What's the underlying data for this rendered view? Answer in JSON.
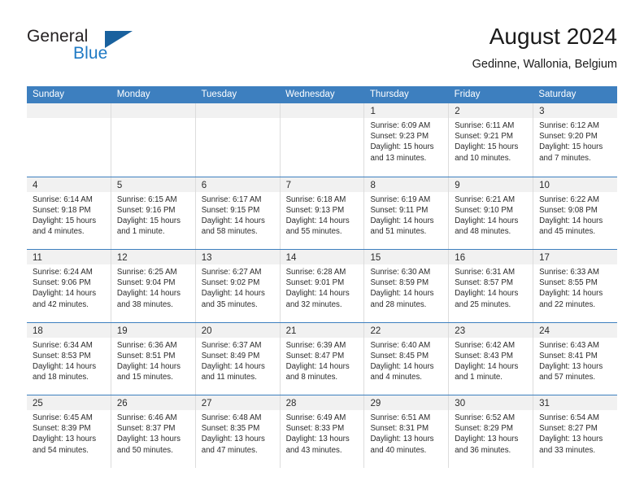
{
  "brand": {
    "name_part1": "General",
    "name_part2": "Blue",
    "flag_color": "#19619e",
    "blue_text_color": "#1f7ac4"
  },
  "header": {
    "title": "August 2024",
    "location": "Gedinne, Wallonia, Belgium",
    "accent_color": "#3d7fbf"
  },
  "weekday_headers": [
    "Sunday",
    "Monday",
    "Tuesday",
    "Wednesday",
    "Thursday",
    "Friday",
    "Saturday"
  ],
  "weeks": [
    [
      {
        "day": "",
        "sunrise": "",
        "sunset": "",
        "daylight1": "",
        "daylight2": ""
      },
      {
        "day": "",
        "sunrise": "",
        "sunset": "",
        "daylight1": "",
        "daylight2": ""
      },
      {
        "day": "",
        "sunrise": "",
        "sunset": "",
        "daylight1": "",
        "daylight2": ""
      },
      {
        "day": "",
        "sunrise": "",
        "sunset": "",
        "daylight1": "",
        "daylight2": ""
      },
      {
        "day": "1",
        "sunrise": "Sunrise: 6:09 AM",
        "sunset": "Sunset: 9:23 PM",
        "daylight1": "Daylight: 15 hours",
        "daylight2": "and 13 minutes."
      },
      {
        "day": "2",
        "sunrise": "Sunrise: 6:11 AM",
        "sunset": "Sunset: 9:21 PM",
        "daylight1": "Daylight: 15 hours",
        "daylight2": "and 10 minutes."
      },
      {
        "day": "3",
        "sunrise": "Sunrise: 6:12 AM",
        "sunset": "Sunset: 9:20 PM",
        "daylight1": "Daylight: 15 hours",
        "daylight2": "and 7 minutes."
      }
    ],
    [
      {
        "day": "4",
        "sunrise": "Sunrise: 6:14 AM",
        "sunset": "Sunset: 9:18 PM",
        "daylight1": "Daylight: 15 hours",
        "daylight2": "and 4 minutes."
      },
      {
        "day": "5",
        "sunrise": "Sunrise: 6:15 AM",
        "sunset": "Sunset: 9:16 PM",
        "daylight1": "Daylight: 15 hours",
        "daylight2": "and 1 minute."
      },
      {
        "day": "6",
        "sunrise": "Sunrise: 6:17 AM",
        "sunset": "Sunset: 9:15 PM",
        "daylight1": "Daylight: 14 hours",
        "daylight2": "and 58 minutes."
      },
      {
        "day": "7",
        "sunrise": "Sunrise: 6:18 AM",
        "sunset": "Sunset: 9:13 PM",
        "daylight1": "Daylight: 14 hours",
        "daylight2": "and 55 minutes."
      },
      {
        "day": "8",
        "sunrise": "Sunrise: 6:19 AM",
        "sunset": "Sunset: 9:11 PM",
        "daylight1": "Daylight: 14 hours",
        "daylight2": "and 51 minutes."
      },
      {
        "day": "9",
        "sunrise": "Sunrise: 6:21 AM",
        "sunset": "Sunset: 9:10 PM",
        "daylight1": "Daylight: 14 hours",
        "daylight2": "and 48 minutes."
      },
      {
        "day": "10",
        "sunrise": "Sunrise: 6:22 AM",
        "sunset": "Sunset: 9:08 PM",
        "daylight1": "Daylight: 14 hours",
        "daylight2": "and 45 minutes."
      }
    ],
    [
      {
        "day": "11",
        "sunrise": "Sunrise: 6:24 AM",
        "sunset": "Sunset: 9:06 PM",
        "daylight1": "Daylight: 14 hours",
        "daylight2": "and 42 minutes."
      },
      {
        "day": "12",
        "sunrise": "Sunrise: 6:25 AM",
        "sunset": "Sunset: 9:04 PM",
        "daylight1": "Daylight: 14 hours",
        "daylight2": "and 38 minutes."
      },
      {
        "day": "13",
        "sunrise": "Sunrise: 6:27 AM",
        "sunset": "Sunset: 9:02 PM",
        "daylight1": "Daylight: 14 hours",
        "daylight2": "and 35 minutes."
      },
      {
        "day": "14",
        "sunrise": "Sunrise: 6:28 AM",
        "sunset": "Sunset: 9:01 PM",
        "daylight1": "Daylight: 14 hours",
        "daylight2": "and 32 minutes."
      },
      {
        "day": "15",
        "sunrise": "Sunrise: 6:30 AM",
        "sunset": "Sunset: 8:59 PM",
        "daylight1": "Daylight: 14 hours",
        "daylight2": "and 28 minutes."
      },
      {
        "day": "16",
        "sunrise": "Sunrise: 6:31 AM",
        "sunset": "Sunset: 8:57 PM",
        "daylight1": "Daylight: 14 hours",
        "daylight2": "and 25 minutes."
      },
      {
        "day": "17",
        "sunrise": "Sunrise: 6:33 AM",
        "sunset": "Sunset: 8:55 PM",
        "daylight1": "Daylight: 14 hours",
        "daylight2": "and 22 minutes."
      }
    ],
    [
      {
        "day": "18",
        "sunrise": "Sunrise: 6:34 AM",
        "sunset": "Sunset: 8:53 PM",
        "daylight1": "Daylight: 14 hours",
        "daylight2": "and 18 minutes."
      },
      {
        "day": "19",
        "sunrise": "Sunrise: 6:36 AM",
        "sunset": "Sunset: 8:51 PM",
        "daylight1": "Daylight: 14 hours",
        "daylight2": "and 15 minutes."
      },
      {
        "day": "20",
        "sunrise": "Sunrise: 6:37 AM",
        "sunset": "Sunset: 8:49 PM",
        "daylight1": "Daylight: 14 hours",
        "daylight2": "and 11 minutes."
      },
      {
        "day": "21",
        "sunrise": "Sunrise: 6:39 AM",
        "sunset": "Sunset: 8:47 PM",
        "daylight1": "Daylight: 14 hours",
        "daylight2": "and 8 minutes."
      },
      {
        "day": "22",
        "sunrise": "Sunrise: 6:40 AM",
        "sunset": "Sunset: 8:45 PM",
        "daylight1": "Daylight: 14 hours",
        "daylight2": "and 4 minutes."
      },
      {
        "day": "23",
        "sunrise": "Sunrise: 6:42 AM",
        "sunset": "Sunset: 8:43 PM",
        "daylight1": "Daylight: 14 hours",
        "daylight2": "and 1 minute."
      },
      {
        "day": "24",
        "sunrise": "Sunrise: 6:43 AM",
        "sunset": "Sunset: 8:41 PM",
        "daylight1": "Daylight: 13 hours",
        "daylight2": "and 57 minutes."
      }
    ],
    [
      {
        "day": "25",
        "sunrise": "Sunrise: 6:45 AM",
        "sunset": "Sunset: 8:39 PM",
        "daylight1": "Daylight: 13 hours",
        "daylight2": "and 54 minutes."
      },
      {
        "day": "26",
        "sunrise": "Sunrise: 6:46 AM",
        "sunset": "Sunset: 8:37 PM",
        "daylight1": "Daylight: 13 hours",
        "daylight2": "and 50 minutes."
      },
      {
        "day": "27",
        "sunrise": "Sunrise: 6:48 AM",
        "sunset": "Sunset: 8:35 PM",
        "daylight1": "Daylight: 13 hours",
        "daylight2": "and 47 minutes."
      },
      {
        "day": "28",
        "sunrise": "Sunrise: 6:49 AM",
        "sunset": "Sunset: 8:33 PM",
        "daylight1": "Daylight: 13 hours",
        "daylight2": "and 43 minutes."
      },
      {
        "day": "29",
        "sunrise": "Sunrise: 6:51 AM",
        "sunset": "Sunset: 8:31 PM",
        "daylight1": "Daylight: 13 hours",
        "daylight2": "and 40 minutes."
      },
      {
        "day": "30",
        "sunrise": "Sunrise: 6:52 AM",
        "sunset": "Sunset: 8:29 PM",
        "daylight1": "Daylight: 13 hours",
        "daylight2": "and 36 minutes."
      },
      {
        "day": "31",
        "sunrise": "Sunrise: 6:54 AM",
        "sunset": "Sunset: 8:27 PM",
        "daylight1": "Daylight: 13 hours",
        "daylight2": "and 33 minutes."
      }
    ]
  ]
}
